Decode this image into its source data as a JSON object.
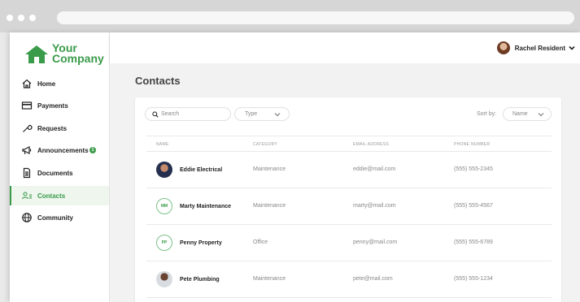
{
  "brand": {
    "line1": "Your",
    "line2": "Company",
    "color": "#3a9b4a"
  },
  "sidebar": {
    "items": [
      {
        "label": "Home",
        "icon": "home-icon"
      },
      {
        "label": "Payments",
        "icon": "credit-card-icon"
      },
      {
        "label": "Requests",
        "icon": "wrench-icon"
      },
      {
        "label": "Announcements",
        "icon": "megaphone-icon",
        "badge": "1"
      },
      {
        "label": "Documents",
        "icon": "document-icon"
      },
      {
        "label": "Contacts",
        "icon": "contacts-icon",
        "active": true
      },
      {
        "label": "Community",
        "icon": "globe-icon"
      }
    ]
  },
  "topbar": {
    "user_name": "Rachel Resident"
  },
  "page": {
    "title": "Contacts"
  },
  "toolbar": {
    "search_placeholder": "Search",
    "type_label": "Type",
    "sort_label": "Sort by:",
    "sort_value": "Name"
  },
  "table": {
    "headers": [
      "NAME",
      "CATEGORY",
      "EMAIL ADDRESS",
      "PHONE NUMBER"
    ],
    "rows": [
      {
        "avatar": "photo",
        "initials": "",
        "name": "Eddie Electrical",
        "category": "Maintenance",
        "email": "eddie@mail.com",
        "phone": "(555) 555-2345"
      },
      {
        "avatar": "initials",
        "initials": "MM",
        "name": "Marty Maintenance",
        "category": "Maintenance",
        "email": "marty@mail.com",
        "phone": "(555) 555-4567"
      },
      {
        "avatar": "initials",
        "initials": "PP",
        "name": "Penny Property",
        "category": "Office",
        "email": "penny@mail.com",
        "phone": "(555) 555-6789"
      },
      {
        "avatar": "photo",
        "initials": "",
        "name": "Pete Plumbing",
        "category": "Maintenance",
        "email": "pete@mail.com",
        "phone": "(555) 555-1234"
      }
    ]
  }
}
